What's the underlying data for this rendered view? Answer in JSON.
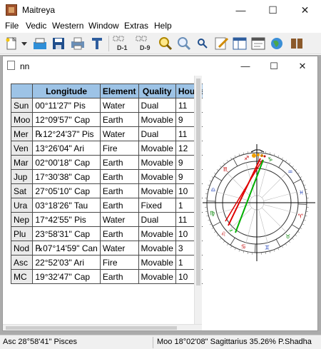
{
  "app": {
    "title": "Maitreya"
  },
  "window_controls": {
    "minimize": "—",
    "maximize": "☐",
    "close": "✕"
  },
  "menu": [
    "File",
    "Vedic",
    "Western",
    "Window",
    "Extras",
    "Help"
  ],
  "toolbar": {
    "icons": [
      "new-doc-icon",
      "open-icon",
      "save-icon",
      "print-icon",
      "print-preview-icon",
      "config-icon",
      "d1-chart-icon",
      "d9-chart-icon",
      "search-icon",
      "zoom-icon",
      "find-icon",
      "edit-icon",
      "table-view-icon",
      "text-view-icon",
      "globe-icon",
      "book-icon"
    ],
    "d1_label": "D-1",
    "d9_label": "D-9"
  },
  "document": {
    "name": "nn",
    "controls": {
      "minimize": "—",
      "maximize": "☐",
      "close": "✕"
    }
  },
  "planet_table": {
    "headers": [
      "",
      "Longitude",
      "Element",
      "Quality",
      "House"
    ],
    "rows": [
      {
        "planet": "Sun",
        "longitude": "00°11'27\" Pis",
        "element": "Water",
        "quality": "Dual",
        "house": "11"
      },
      {
        "planet": "Moo",
        "longitude": "12°09'57\" Cap",
        "element": "Earth",
        "quality": "Movable",
        "house": "9"
      },
      {
        "planet": "Mer",
        "longitude": "℞12°24'37\" Pis",
        "element": "Water",
        "quality": "Dual",
        "house": "11"
      },
      {
        "planet": "Ven",
        "longitude": "13°26'04\" Ari",
        "element": "Fire",
        "quality": "Movable",
        "house": "12"
      },
      {
        "planet": "Mar",
        "longitude": "02°00'18\" Cap",
        "element": "Earth",
        "quality": "Movable",
        "house": "9"
      },
      {
        "planet": "Jup",
        "longitude": "17°30'38\" Cap",
        "element": "Earth",
        "quality": "Movable",
        "house": "9"
      },
      {
        "planet": "Sat",
        "longitude": "27°05'10\" Cap",
        "element": "Earth",
        "quality": "Movable",
        "house": "10"
      },
      {
        "planet": "Ura",
        "longitude": "03°18'26\" Tau",
        "element": "Earth",
        "quality": "Fixed",
        "house": "1"
      },
      {
        "planet": "Nep",
        "longitude": "17°42'55\" Pis",
        "element": "Water",
        "quality": "Dual",
        "house": "11"
      },
      {
        "planet": "Plu",
        "longitude": "23°58'31\" Cap",
        "element": "Earth",
        "quality": "Movable",
        "house": "10"
      },
      {
        "planet": "Nod",
        "longitude": "℞07°14'59\" Can",
        "element": "Water",
        "quality": "Movable",
        "house": "3"
      },
      {
        "planet": "Asc",
        "longitude": "22°52'03\" Ari",
        "element": "Fire",
        "quality": "Movable",
        "house": "1"
      },
      {
        "planet": "MC",
        "longitude": "19°32'47\" Cap",
        "element": "Earth",
        "quality": "Movable",
        "house": "10"
      }
    ]
  },
  "status": {
    "left": "Asc 28°58'41\" Pisces",
    "right": "Moo 18°02'08\" Sagittarius 35.26% P.Shadha"
  },
  "colors": {
    "header_bg": "#9dc3e6",
    "aspect_red": "#e00000",
    "aspect_green": "#00b000",
    "sun_marker": "#f0a000"
  }
}
